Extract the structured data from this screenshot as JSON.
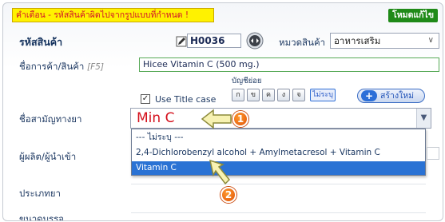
{
  "warning_banner": "คำเตือน - รหัสสินค้าผิดไปจากรูปแบบที่กำหนด !",
  "mode_badge": "โหมดแก้ไข",
  "product_code": {
    "label": "รหัสสินค้า",
    "value": "H0036"
  },
  "category": {
    "label": "หมวดสินค้า",
    "selected": "อาหารเสริม"
  },
  "trade_name": {
    "label": "ชื่อการค้า/สินค้า",
    "hint": "[F5]",
    "value": "Hicee Vitamin C (500 mg.)"
  },
  "sub_category": {
    "label": "บัญชีย่อย",
    "buttons": [
      "ก",
      "ข",
      "ค",
      "ง",
      "จ",
      "ไม่ระบุ"
    ]
  },
  "use_title_case": {
    "label": "Use Title case",
    "checked": "✓"
  },
  "new_button": {
    "icon": "+",
    "label": "สร้างใหม่"
  },
  "generic_name": {
    "label": "ชื่อสามัญทางยา",
    "value": "Min C",
    "options": [
      "--- ไม่ระบุ ---",
      "2,4-Dichlorobenzyl alcohol + Amylmetacresol + Vitamin C",
      "Vitamin C"
    ],
    "selected_index": 2
  },
  "manufacturer_label": "ผู้ผลิต/ผู้นำเข้า",
  "type_label": "ประเภทยา",
  "package_label": "ขนาดบรรจุ",
  "callouts": {
    "step1": "1",
    "step2": "2"
  },
  "colors": {
    "warning_bg": "#fff200",
    "warning_text": "#d1102b",
    "mode_bg": "#1f8a18",
    "selected_option": "#2a72d4",
    "generic_text": "#d4101c",
    "callout": "#ee6a12"
  },
  "icons": {
    "edit": "pencil-icon",
    "nav": "navigate-arrows-icon",
    "dropdown": "chevron-down-icon",
    "arrow1": "arrow-left-icon",
    "arrow2": "cursor-arrow-icon"
  }
}
